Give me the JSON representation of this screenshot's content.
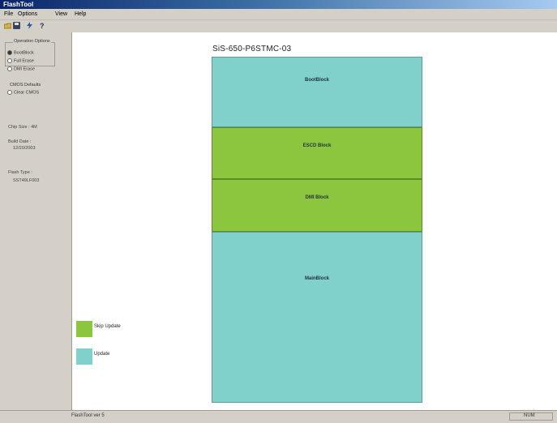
{
  "window": {
    "title": "FlashTool"
  },
  "menu": {
    "file": "File",
    "options": "Options",
    "view": "View",
    "help": "Help"
  },
  "options_group": {
    "label": "Operation Options",
    "items": [
      {
        "label": "BootBlock",
        "selected": true
      },
      {
        "label": "Full Erase",
        "selected": false
      },
      {
        "label": "DMI Erase",
        "selected": false
      },
      {
        "label": "CMOS Defaults",
        "selected": false
      },
      {
        "label": "Clear CMOS",
        "selected": false
      }
    ]
  },
  "info": {
    "chip_size_label": "Chip Size : 4M",
    "build_date_label": "Build Date :",
    "build_date_value": "12/20/2003",
    "flash_type_label": "Flash Type :",
    "flash_type_value": "SST49LF003"
  },
  "diagram": {
    "title": "SiS-650-P6STMC-03",
    "blocks": [
      {
        "label": "BootBlock",
        "type": "update"
      },
      {
        "label": "ESCD Block",
        "type": "skip"
      },
      {
        "label": "DMI Block",
        "type": "skip"
      },
      {
        "label": "MainBlock",
        "type": "update"
      }
    ]
  },
  "legend": {
    "skip_label": "Skip Update",
    "update_label": "Update",
    "skip_color": "#8cc63f",
    "update_color": "#80d0cc"
  },
  "status": {
    "left": "FlashTool ver 5",
    "right": "NUM"
  },
  "icons": [
    "open-icon",
    "save-icon",
    "flash-icon",
    "help-icon"
  ]
}
